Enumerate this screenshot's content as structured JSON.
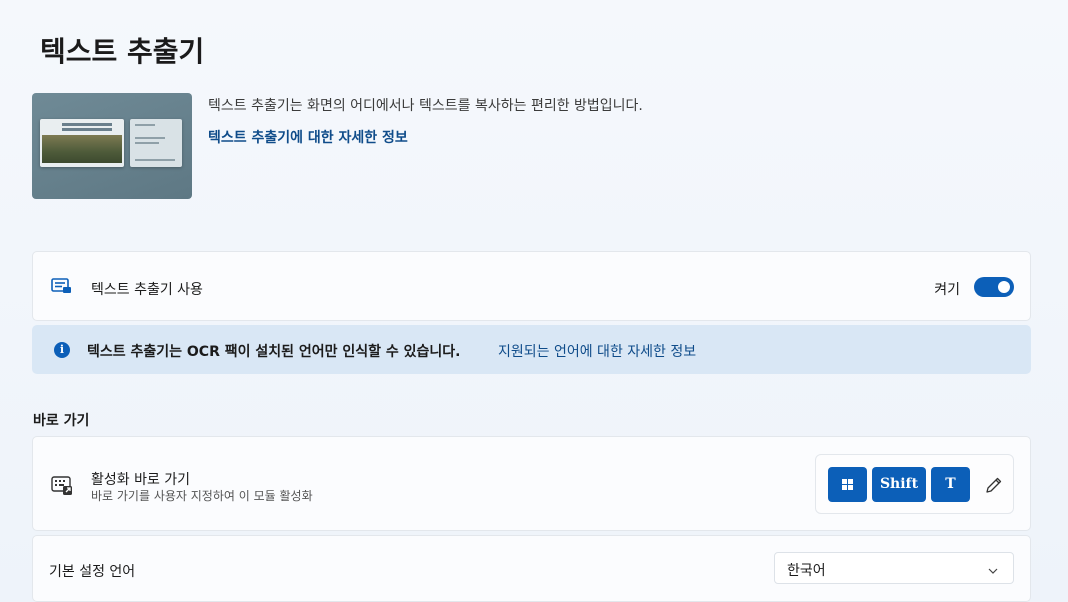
{
  "page": {
    "title": "텍스트 추출기"
  },
  "hero": {
    "description": "텍스트 추출기는 화면의 어디에서나 텍스트를 복사하는 편리한 방법입니다.",
    "learn_more_link": "텍스트 추출기에 대한 자세한 정보",
    "image_icon": "text-extractor-preview"
  },
  "enable": {
    "label": "텍스트 추출기 사용",
    "state_label": "켜기",
    "toggle_on": true,
    "icon": "text-extractor-icon"
  },
  "info": {
    "message": "텍스트 추출기는 OCR 팩이 설치된 언어만 인식할 수 있습니다.",
    "link": "지원되는 언어에 대한 자세한 정보",
    "icon": "info-icon"
  },
  "shortcut_section": {
    "title": "바로 가기",
    "activation": {
      "label": "활성화 바로 가기",
      "description": "바로 가기를 사용자 지정하여 이 모듈 활성화",
      "icon": "keyboard-icon",
      "keys": [
        "win",
        "Shift",
        "T"
      ],
      "edit_icon": "pencil-icon"
    }
  },
  "language": {
    "label": "기본 설정 언어",
    "selected": "한국어",
    "chevron_icon": "chevron-down-icon"
  },
  "colors": {
    "accent": "#0c5fb8",
    "info_background": "#d9e7f5",
    "link": "#0f4c8a"
  }
}
